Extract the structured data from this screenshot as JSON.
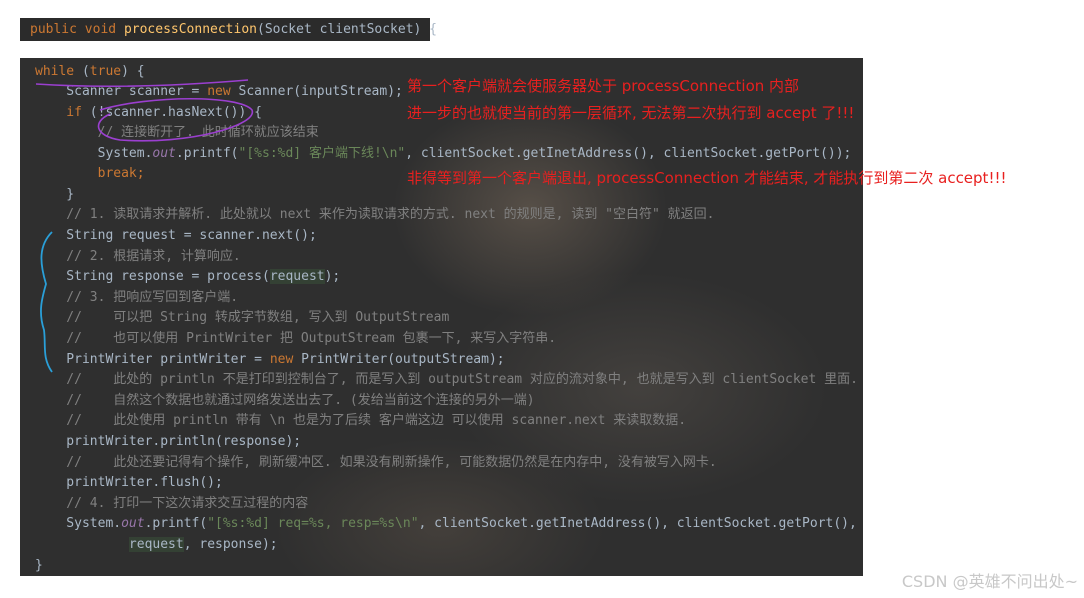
{
  "header": {
    "kw1": "public",
    "kw2": "void",
    "method": "processConnection",
    "params": "(Socket clientSocket) {"
  },
  "code": {
    "l1_kw": "while",
    "l1_rest": " (",
    "l1_true": "true",
    "l1_end": ") {",
    "l2_a": "    Scanner scanner = ",
    "l2_new": "new",
    "l2_b": " Scanner(inputStream);",
    "l3_if": "    if",
    "l3_rest": " (!scanner.hasNext()) {",
    "l4": "        // 连接断开了. 此时循环就应该结束",
    "l5_a": "        System.",
    "l5_out": "out",
    "l5_b": ".printf(",
    "l5_str": "\"[%s:%d] 客户端下线!\\n\"",
    "l5_c": ", clientSocket.getInetAddress(), clientSocket.getPort());",
    "l6": "        break;",
    "l7": "    }",
    "l8": "    // 1. 读取请求并解析. 此处就以 next 来作为读取请求的方式. next 的规则是, 读到 \"空白符\" 就返回.",
    "l9_a": "    String ",
    "l9_req": "request",
    "l9_b": " = scanner.next();",
    "l10": "    // 2. 根据请求, 计算响应.",
    "l11_a": "    String response = process(",
    "l11_req": "request",
    "l11_b": ");",
    "l12": "    // 3. 把响应写回到客户端.",
    "l13": "    //    可以把 String 转成字节数组, 写入到 OutputStream",
    "l14": "    //    也可以使用 PrintWriter 把 OutputStream 包裹一下, 来写入字符串.",
    "l15_a": "    PrintWriter printWriter = ",
    "l15_new": "new",
    "l15_b": " PrintWriter(outputStream);",
    "l16": "    //    此处的 println 不是打印到控制台了, 而是写入到 outputStream 对应的流对象中, 也就是写入到 clientSocket 里面.",
    "l17": "    //    自然这个数据也就通过网络发送出去了. (发给当前这个连接的另外一端)",
    "l18": "    //    此处使用 println 带有 \\n 也是为了后续 客户端这边 可以使用 scanner.next 来读取数据.",
    "l19": "    printWriter.println(response);",
    "l20": "    //    此处还要记得有个操作, 刷新缓冲区. 如果没有刷新操作, 可能数据仍然是在内存中, 没有被写入网卡.",
    "l21": "    printWriter.flush();",
    "l22": "    // 4. 打印一下这次请求交互过程的内容",
    "l23_a": "    System.",
    "l23_out": "out",
    "l23_b": ".printf(",
    "l23_str": "\"[%s:%d] req=%s, resp=%s\\n\"",
    "l23_c": ", clientSocket.getInetAddress(), clientSocket.getPort(),",
    "l24_pad": "            ",
    "l24_req": "request",
    "l24_b": ", response);",
    "l25": "}"
  },
  "annotations": {
    "line1": "第一个客户端就会使服务器处于 processConnection 内部",
    "line2": "进一步的也就使当前的第一层循环, 无法第二次执行到 accept 了!!!",
    "line3": "非得等到第一个客户端退出, processConnection 才能结束, 才能执行到第二次 accept!!!"
  },
  "watermark": "CSDN @英雄不问出处~",
  "colors": {
    "annotation": "#e8201f",
    "pen_marks": "#2a9fd8",
    "circle_mark": "#9b3fd0",
    "editor_bg": "#2f2f2f"
  }
}
